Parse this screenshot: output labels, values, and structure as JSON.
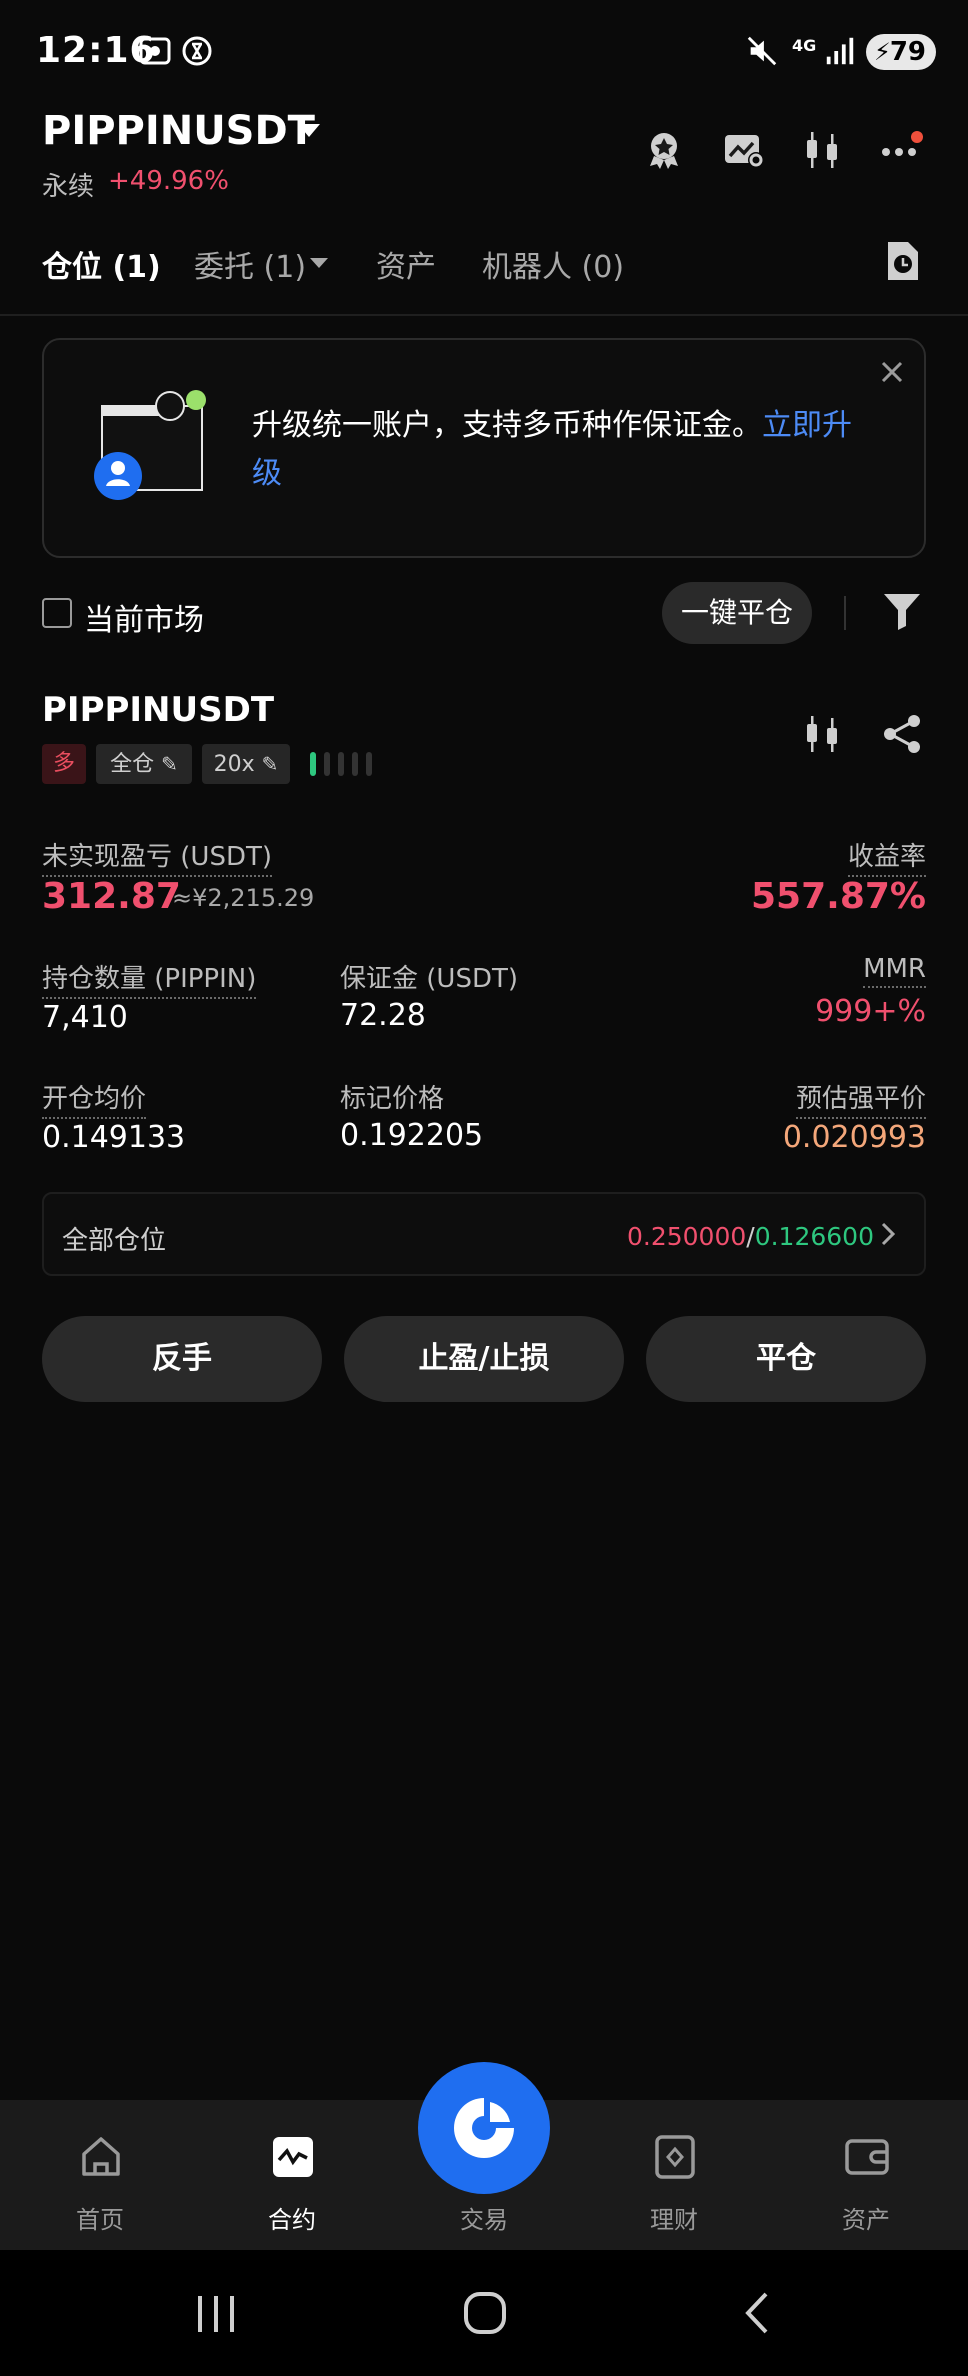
{
  "status_bar": {
    "time": "12:16",
    "network": "4G",
    "battery": "79"
  },
  "header": {
    "symbol": "PIPPINUSDT",
    "contract_type": "永续",
    "change": "+49.96%",
    "icons": [
      "award-icon",
      "chart-settings-icon",
      "candlestick-icon",
      "more-icon"
    ]
  },
  "tabs": [
    {
      "label": "仓位 (1)",
      "active": true
    },
    {
      "label": "委托 (1)",
      "active": false
    },
    {
      "label": "资产",
      "active": false
    },
    {
      "label": "机器人 (0)",
      "active": false
    }
  ],
  "banner": {
    "text": "升级统一账户，支持多币种作保证金。",
    "link": "立即升级"
  },
  "filter_bar": {
    "current_market_label": "当前市场",
    "close_all_label": "一键平仓"
  },
  "position": {
    "symbol": "PIPPINUSDT",
    "side": "多",
    "margin_mode": "全仓",
    "leverage": "20x",
    "adl_level": 1,
    "unrealized_pnl_label": "未实现盈亏 (USDT)",
    "unrealized_pnl": "312.87",
    "unrealized_pnl_cny": "≈¥2,215.29",
    "roe_label": "收益率",
    "roe": "557.87%",
    "size_label": "持仓数量 (PIPPIN)",
    "size": "7,410",
    "margin_label": "保证金 (USDT)",
    "margin": "72.28",
    "mmr_label": "MMR",
    "mmr": "999+%",
    "entry_price_label": "开仓均价",
    "entry_price": "0.149133",
    "mark_price_label": "标记价格",
    "mark_price": "0.192205",
    "liq_price_label": "预估强平价",
    "liq_price": "0.020993",
    "all_positions_label": "全部仓位",
    "tp_price": "0.250000",
    "sl_price": "0.126600",
    "separator": "/"
  },
  "actions": {
    "reverse": "反手",
    "tpsl": "止盈/止损",
    "close": "平仓"
  },
  "bottom_nav": [
    {
      "label": "首页"
    },
    {
      "label": "合约"
    },
    {
      "label": "交易"
    },
    {
      "label": "理财"
    },
    {
      "label": "资产"
    }
  ],
  "colors": {
    "accent": "#1f6ef0",
    "up_red": "#f0506e",
    "down_green": "#2ec77f",
    "liq_orange": "#f4a77a",
    "link_blue": "#4d8bf5"
  }
}
